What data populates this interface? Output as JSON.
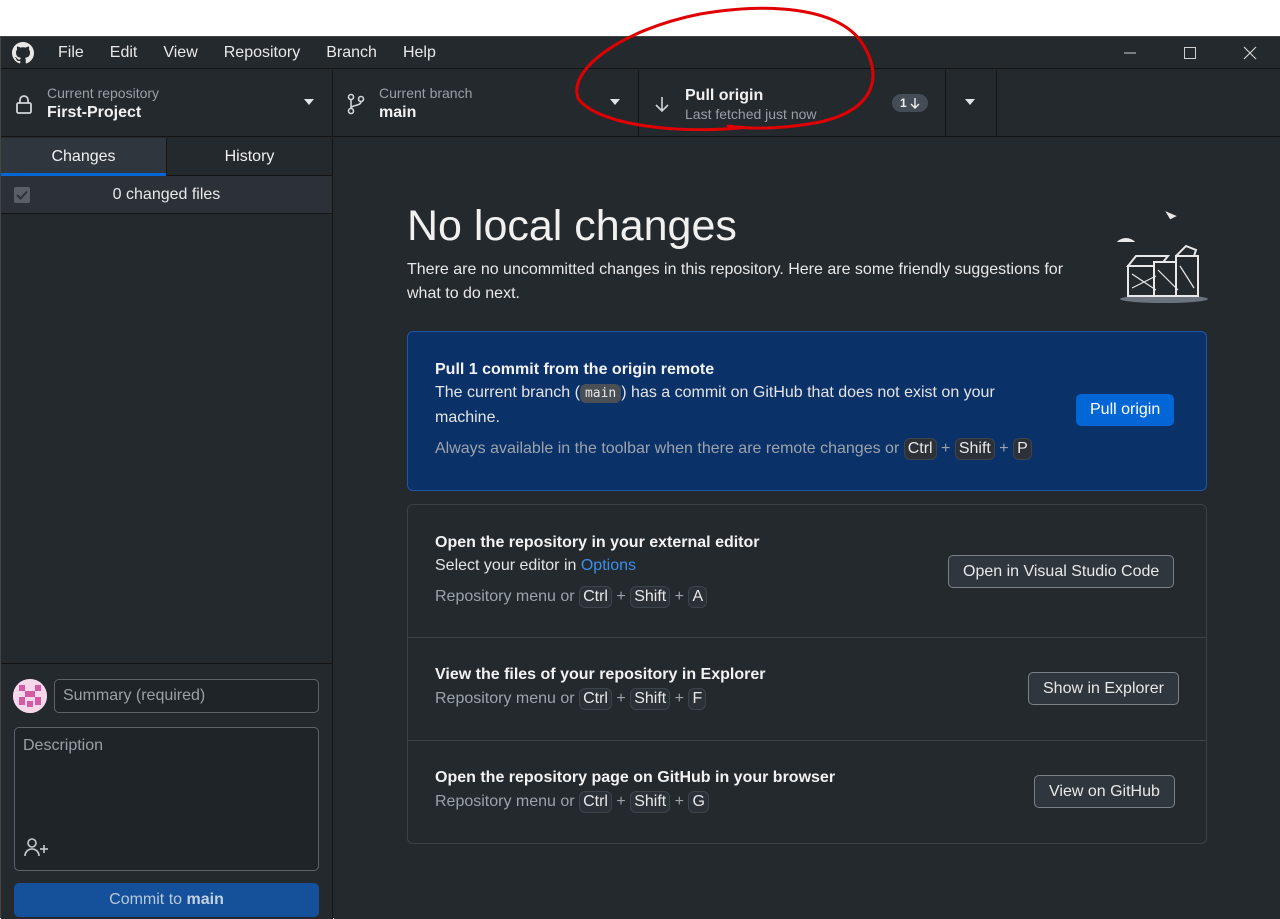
{
  "menu": [
    "File",
    "Edit",
    "View",
    "Repository",
    "Branch",
    "Help"
  ],
  "toolbar": {
    "repo_caption": "Current repository",
    "repo_name": "First-Project",
    "branch_caption": "Current branch",
    "branch_name": "main",
    "pull_title": "Pull origin",
    "pull_sub": "Last fetched just now",
    "pull_badge": "1"
  },
  "sidebar": {
    "tabs": [
      "Changes",
      "History"
    ],
    "changed_files": "0 changed files",
    "summary_placeholder": "Summary (required)",
    "description_placeholder": "Description",
    "commit_prefix": "Commit to",
    "commit_branch": "main"
  },
  "main": {
    "title": "No local changes",
    "intro": "There are no uncommitted changes in this repository. Here are some friendly suggestions for what to do next.",
    "pull_card": {
      "title": "Pull 1 commit from the origin remote",
      "text_before": "The current branch (",
      "branch": "main",
      "text_after": ") has a commit on GitHub that does not exist on your machine.",
      "hint": "Always available in the toolbar when there are remote changes or",
      "keys": [
        "Ctrl",
        "Shift",
        "P"
      ],
      "button": "Pull origin"
    },
    "editor_row": {
      "title": "Open the repository in your external editor",
      "text": "Select your editor in",
      "link": "Options",
      "hint": "Repository menu or",
      "keys": [
        "Ctrl",
        "Shift",
        "A"
      ],
      "button": "Open in Visual Studio Code"
    },
    "explorer_row": {
      "title": "View the files of your repository in Explorer",
      "hint": "Repository menu or",
      "keys": [
        "Ctrl",
        "Shift",
        "F"
      ],
      "button": "Show in Explorer"
    },
    "github_row": {
      "title": "Open the repository page on GitHub in your browser",
      "hint": "Repository menu or",
      "keys": [
        "Ctrl",
        "Shift",
        "G"
      ],
      "button": "View on GitHub"
    }
  },
  "colors": {
    "background": "#24292e",
    "accent": "#0366d6",
    "pull_card_bg": "#0b3169",
    "annotation": "#e00000"
  }
}
